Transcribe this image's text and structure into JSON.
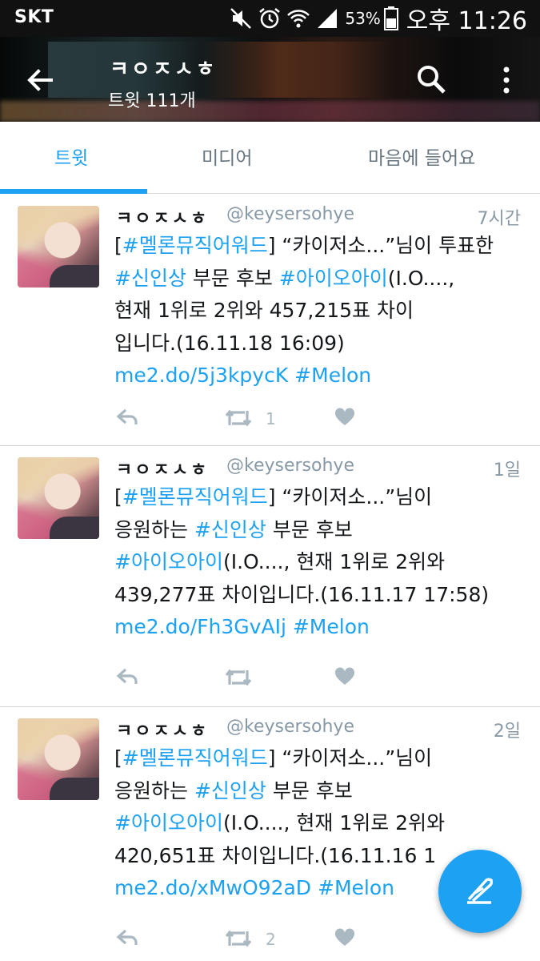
{
  "statusbar": {
    "carrier": "SKT",
    "battery": "53%",
    "clock": "오후 11:26"
  },
  "header": {
    "title": "ㅋㅇㅈㅅㅎ",
    "tweet_count": "트윗 111개"
  },
  "tabs": [
    {
      "label": "트윗",
      "active": true
    },
    {
      "label": "미디어",
      "active": false
    },
    {
      "label": "마음에 들어요",
      "active": false
    }
  ],
  "tweets": [
    {
      "name": "ㅋㅇㅈㅅㅎ",
      "handle": "@keysersohye",
      "time": "7시간",
      "lines": [
        [
          {
            "t": "[",
            "l": false
          },
          {
            "t": "#멜론뮤직어워드",
            "l": true
          },
          {
            "t": "] “카이저소...”님이 투표한",
            "l": false
          }
        ],
        [
          {
            "t": "#신인상",
            "l": true
          },
          {
            "t": " 부문 후보 ",
            "l": false
          },
          {
            "t": "#아이오아이",
            "l": true
          },
          {
            "t": "(I.O....,",
            "l": false
          }
        ],
        [
          {
            "t": "현재 1위로 2위와 457,215표 차이",
            "l": false
          }
        ],
        [
          {
            "t": "입니다.(16.11.18 16:09)",
            "l": false
          }
        ],
        [
          {
            "t": "me2.do/5j3kpycK",
            "l": true
          },
          {
            "t": " ",
            "l": false
          },
          {
            "t": "#Melon",
            "l": true
          }
        ]
      ],
      "retweets": "1",
      "likes": ""
    },
    {
      "name": "ㅋㅇㅈㅅㅎ",
      "handle": "@keysersohye",
      "time": "1일",
      "lines": [
        [
          {
            "t": "[",
            "l": false
          },
          {
            "t": "#멜론뮤직어워드",
            "l": true
          },
          {
            "t": "] “카이저소...”님이",
            "l": false
          }
        ],
        [
          {
            "t": "응원하는 ",
            "l": false
          },
          {
            "t": "#신인상",
            "l": true
          },
          {
            "t": " 부문 후보",
            "l": false
          }
        ],
        [
          {
            "t": "#아이오아이",
            "l": true
          },
          {
            "t": "(I.O...., 현재 1위로 2위와",
            "l": false
          }
        ],
        [
          {
            "t": "439,277표 차이입니다.(16.11.17 17:58)",
            "l": false
          }
        ],
        [
          {
            "t": "me2.do/Fh3GvAIj",
            "l": true
          },
          {
            "t": " ",
            "l": false
          },
          {
            "t": "#Melon",
            "l": true
          }
        ]
      ],
      "retweets": "",
      "likes": ""
    },
    {
      "name": "ㅋㅇㅈㅅㅎ",
      "handle": "@keysersohye",
      "time": "2일",
      "lines": [
        [
          {
            "t": "[",
            "l": false
          },
          {
            "t": "#멜론뮤직어워드",
            "l": true
          },
          {
            "t": "] “카이저소...”님이",
            "l": false
          }
        ],
        [
          {
            "t": "응원하는 ",
            "l": false
          },
          {
            "t": "#신인상",
            "l": true
          },
          {
            "t": " 부문 후보",
            "l": false
          }
        ],
        [
          {
            "t": "#아이오아이",
            "l": true
          },
          {
            "t": "(I.O...., 현재 1위로 2위와",
            "l": false
          }
        ],
        [
          {
            "t": "420,651표 차이입니다.(16.11.16 1",
            "l": false
          }
        ],
        [
          {
            "t": "me2.do/xMwO92aD",
            "l": true
          },
          {
            "t": " ",
            "l": false
          },
          {
            "t": "#Melon",
            "l": true
          }
        ]
      ],
      "retweets": "2",
      "likes": ""
    }
  ],
  "icons": {
    "back": "arrow-left-icon",
    "search": "search-icon",
    "more": "more-vertical-icon",
    "reply": "reply-icon",
    "retweet": "retweet-icon",
    "like": "heart-icon",
    "compose": "compose-icon"
  },
  "colors": {
    "accent": "#1da1f2",
    "text": "#14171a",
    "secondary": "#8899a6",
    "action": "#aab8c2"
  }
}
